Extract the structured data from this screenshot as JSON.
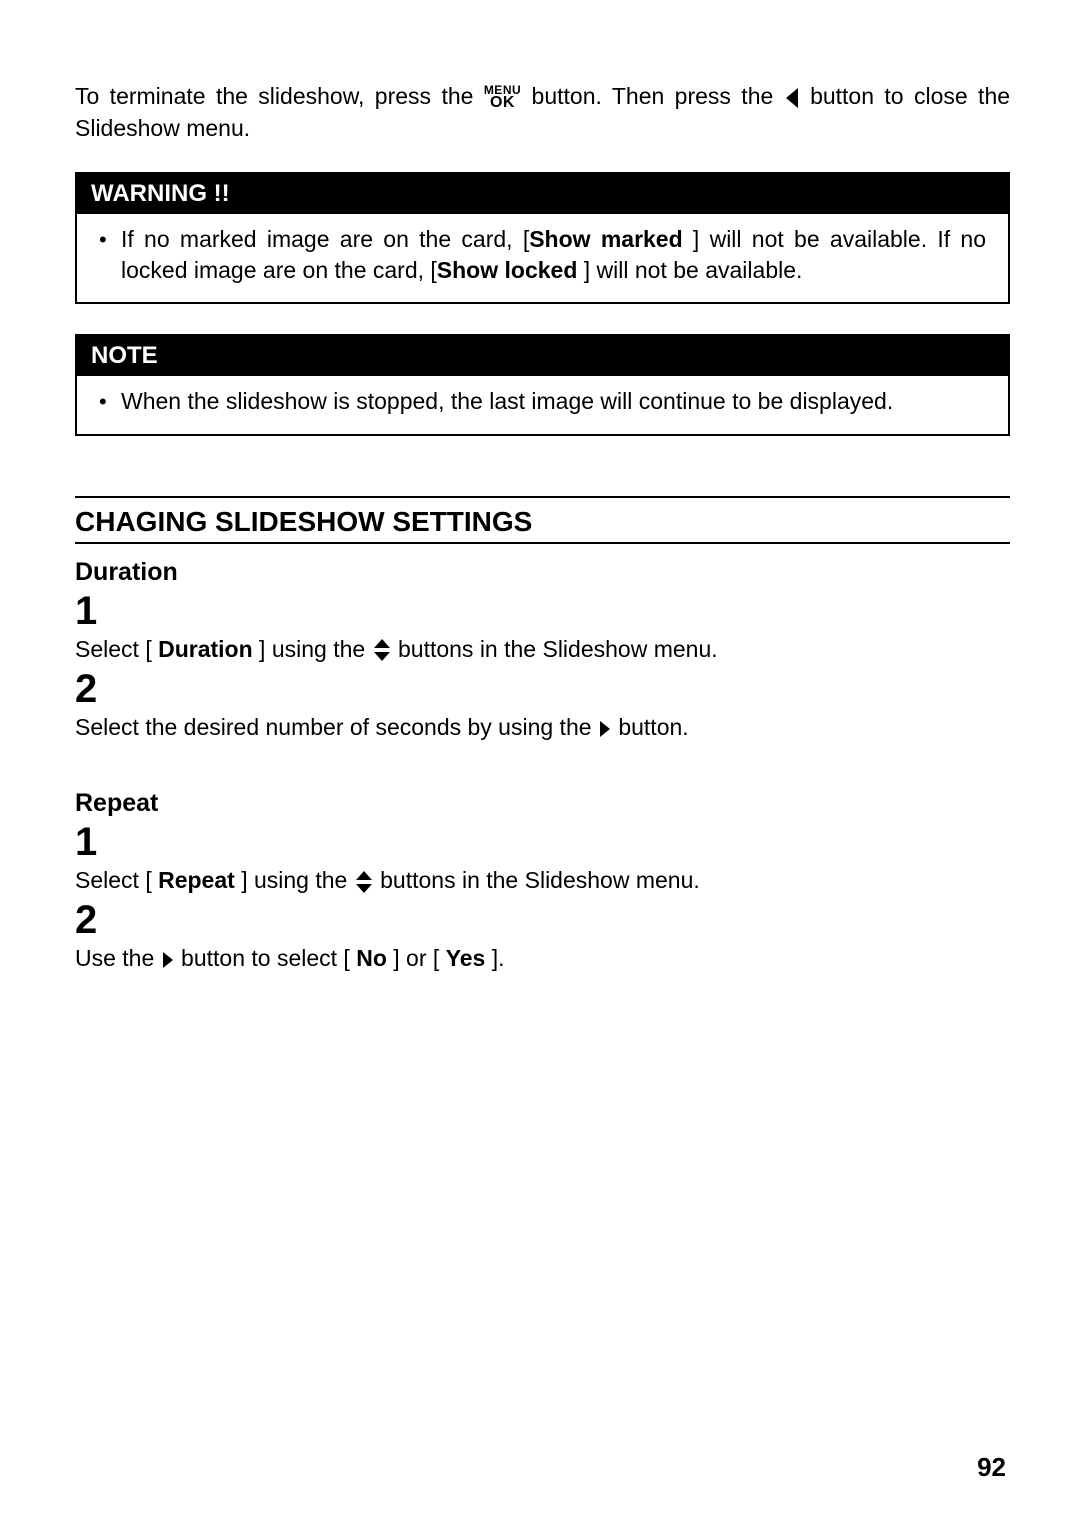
{
  "intro": {
    "part1": "To  terminate  the  slideshow,  press  the",
    "part2": "button.  Then  press  the",
    "part3": "button to close the Slideshow menu.",
    "menu_label": "MENU",
    "ok_label": "OK"
  },
  "warning": {
    "header": "WARNING !!",
    "text_pre": "If no marked image are on the card, [",
    "show_marked": "Show marked",
    "text_mid": " ] will not be available. If no locked image are on the card, [",
    "show_locked": "Show locked",
    "text_post": " ] will not be available."
  },
  "note": {
    "header": "NOTE",
    "text": "When the slideshow is stopped, the last image will continue to be displayed."
  },
  "section_title": "CHAGING SLIDESHOW SETTINGS",
  "duration": {
    "heading": "Duration",
    "num1": "1",
    "line1_pre": "Select [ ",
    "line1_bold": "Duration",
    "line1_mid": " ] using the ",
    "line1_post": " buttons in the Slideshow menu.",
    "num2": "2",
    "line2_pre": "Select the desired number of seconds by using the ",
    "line2_post": " button."
  },
  "repeat": {
    "heading": "Repeat",
    "num1": "1",
    "line1_pre": "Select [ ",
    "line1_bold": "Repeat",
    "line1_mid": " ] using the ",
    "line1_post": " buttons in the Slideshow menu.",
    "num2": "2",
    "line2_pre": "Use the ",
    "line2_mid": " button to select [ ",
    "line2_no": "No",
    "line2_or": " ] or [ ",
    "line2_yes": "Yes",
    "line2_post": " ]."
  },
  "page_number": "92"
}
